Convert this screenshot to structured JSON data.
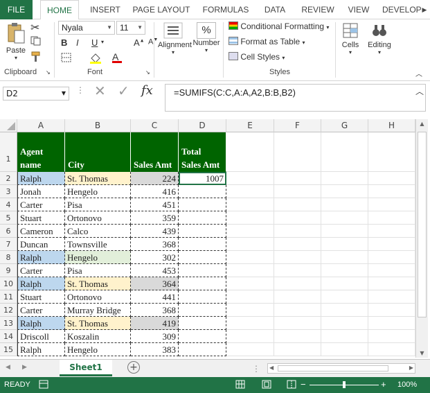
{
  "ribbon_tabs": [
    "FILE",
    "HOME",
    "INSERT",
    "PAGE LAYOUT",
    "FORMULAS",
    "DATA",
    "REVIEW",
    "VIEW",
    "DEVELOP"
  ],
  "ribbon": {
    "paste_label": "Paste",
    "clipboard_label": "Clipboard",
    "font_name": "Nyala",
    "font_size": "11",
    "font_label": "Font",
    "alignment_label": "Alignment",
    "number_label": "Number",
    "conditional_formatting": "Conditional Formatting",
    "format_as_table": "Format as Table",
    "cell_styles": "Cell Styles",
    "styles_label": "Styles",
    "cells_label": "Cells",
    "editing_label": "Editing",
    "bold": "B",
    "italic": "I",
    "underline": "U",
    "percent": "%"
  },
  "formula_bar": {
    "name_box": "D2",
    "formula": "=SUMIFS(C:C,A:A,A2,B:B,B2)",
    "fx": "fx"
  },
  "columns": [
    "A",
    "B",
    "C",
    "D",
    "E",
    "F",
    "G",
    "H"
  ],
  "headers": {
    "A": [
      "Agent",
      "name"
    ],
    "B": "City",
    "C": "Sales Amt",
    "D": [
      "Total",
      "Sales Amt"
    ]
  },
  "rows": [
    {
      "n": "2",
      "a": "Ralph",
      "b": "St. Thomas",
      "c": "224",
      "d": "1007"
    },
    {
      "n": "3",
      "a": "Jonah",
      "b": "Hengelo",
      "c": "416",
      "d": ""
    },
    {
      "n": "4",
      "a": "Carter",
      "b": "Pisa",
      "c": "451",
      "d": ""
    },
    {
      "n": "5",
      "a": "Stuart",
      "b": "Ortonovo",
      "c": "359",
      "d": ""
    },
    {
      "n": "6",
      "a": "Cameron",
      "b": "Calco",
      "c": "439",
      "d": ""
    },
    {
      "n": "7",
      "a": "Duncan",
      "b": "Townsville",
      "c": "368",
      "d": ""
    },
    {
      "n": "8",
      "a": "Ralph",
      "b": "Hengelo",
      "c": "302",
      "d": ""
    },
    {
      "n": "9",
      "a": "Carter",
      "b": "Pisa",
      "c": "453",
      "d": ""
    },
    {
      "n": "10",
      "a": "Ralph",
      "b": "St. Thomas",
      "c": "364",
      "d": ""
    },
    {
      "n": "11",
      "a": "Stuart",
      "b": "Ortonovo",
      "c": "441",
      "d": ""
    },
    {
      "n": "12",
      "a": "Carter",
      "b": "Murray Bridge",
      "c": "368",
      "d": ""
    },
    {
      "n": "13",
      "a": "Ralph",
      "b": "St. Thomas",
      "c": "419",
      "d": ""
    },
    {
      "n": "14",
      "a": "Driscoll",
      "b": "Koszalin",
      "c": "309",
      "d": ""
    },
    {
      "n": "15",
      "a": "Ralph",
      "b": "Hengelo",
      "c": "383",
      "d": ""
    }
  ],
  "row1_label": "1",
  "sheet_tab": "Sheet1",
  "status": {
    "ready": "READY",
    "zoom": "100%"
  },
  "colors": {
    "excel_green": "#217346",
    "header_green": "#006400",
    "highlight_blue": "#bdd7ee",
    "highlight_yellow": "#fff2cc",
    "highlight_gray": "#d9d9d9",
    "highlight_green": "#e2efda"
  }
}
